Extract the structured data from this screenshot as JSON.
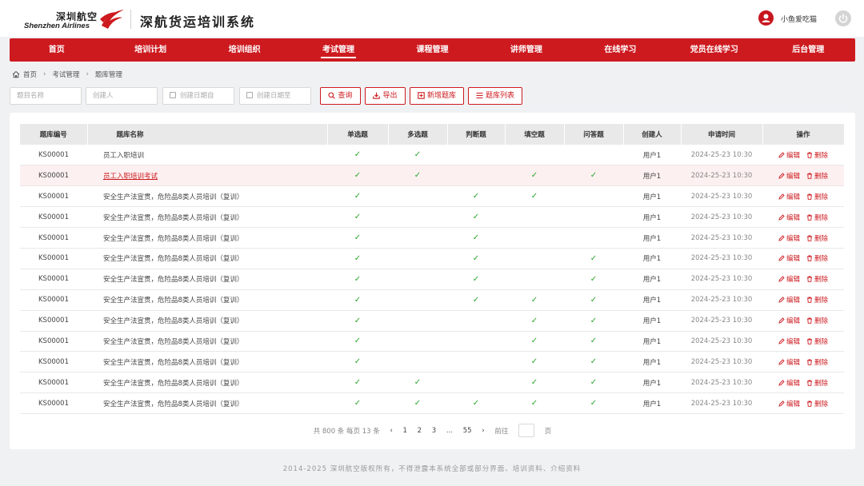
{
  "brand": {
    "logo_cn": "深圳航空",
    "logo_en": "Shenzhen Airlines",
    "system_title": "深航货运培训系统",
    "accent_color": "#cd1a1f"
  },
  "user": {
    "name": "小鱼爱吃猫",
    "avatar_icon": "user-icon",
    "logout_icon": "power-icon"
  },
  "nav": {
    "items": [
      {
        "label": "首页"
      },
      {
        "label": "培训计划"
      },
      {
        "label": "培训组织"
      },
      {
        "label": "考试管理"
      },
      {
        "label": "课程管理"
      },
      {
        "label": "讲师管理"
      },
      {
        "label": "在线学习"
      },
      {
        "label": "党员在线学习"
      },
      {
        "label": "后台管理"
      }
    ],
    "active_index": 3
  },
  "breadcrumb": {
    "home": "首页",
    "level1": "考试管理",
    "level2": "题库管理"
  },
  "filters": {
    "name_placeholder": "题目名称",
    "creator_placeholder": "创建人",
    "date_from_placeholder": "创建日期自",
    "date_to_placeholder": "创建日期至",
    "search_label": "查询",
    "export_label": "导出",
    "add_label": "新增题库",
    "list_label": "题库列表"
  },
  "table": {
    "headers": [
      "题库编号",
      "题库名称",
      "单选题",
      "多选题",
      "判断题",
      "填空题",
      "问答题",
      "创建人",
      "申请时间",
      "操作"
    ],
    "edit_label": "编辑",
    "delete_label": "删除",
    "check_mark": "✓",
    "rows": [
      {
        "id": "KS00001",
        "name": "员工入职培训",
        "single": true,
        "multi": true,
        "judge": false,
        "fill": false,
        "qa": false,
        "creator": "用户1",
        "time": "2024-25-23 10:30",
        "highlight": false
      },
      {
        "id": "KS00001",
        "name": "员工入职培训考试",
        "single": true,
        "multi": true,
        "judge": false,
        "fill": true,
        "qa": true,
        "creator": "用户1",
        "time": "2024-25-23 10:30",
        "highlight": true
      },
      {
        "id": "KS00001",
        "name": "安全生产法宣贯，危险品8类人员培训（复训）",
        "single": true,
        "multi": false,
        "judge": true,
        "fill": true,
        "qa": false,
        "creator": "用户1",
        "time": "2024-25-23 10:30",
        "highlight": false
      },
      {
        "id": "KS00001",
        "name": "安全生产法宣贯，危险品8类人员培训（复训）",
        "single": true,
        "multi": false,
        "judge": true,
        "fill": false,
        "qa": false,
        "creator": "用户1",
        "time": "2024-25-23 10:30",
        "highlight": false
      },
      {
        "id": "KS00001",
        "name": "安全生产法宣贯，危险品8类人员培训（复训）",
        "single": true,
        "multi": false,
        "judge": true,
        "fill": false,
        "qa": false,
        "creator": "用户1",
        "time": "2024-25-23 10:30",
        "highlight": false
      },
      {
        "id": "KS00001",
        "name": "安全生产法宣贯，危险品8类人员培训（复训）",
        "single": true,
        "multi": false,
        "judge": true,
        "fill": false,
        "qa": true,
        "creator": "用户1",
        "time": "2024-25-23 10:30",
        "highlight": false
      },
      {
        "id": "KS00001",
        "name": "安全生产法宣贯，危险品8类人员培训（复训）",
        "single": true,
        "multi": false,
        "judge": true,
        "fill": false,
        "qa": true,
        "creator": "用户1",
        "time": "2024-25-23 10:30",
        "highlight": false
      },
      {
        "id": "KS00001",
        "name": "安全生产法宣贯，危险品8类人员培训（复训）",
        "single": true,
        "multi": false,
        "judge": true,
        "fill": true,
        "qa": true,
        "creator": "用户1",
        "time": "2024-25-23 10:30",
        "highlight": false
      },
      {
        "id": "KS00001",
        "name": "安全生产法宣贯，危险品8类人员培训（复训）",
        "single": true,
        "multi": false,
        "judge": false,
        "fill": true,
        "qa": true,
        "creator": "用户1",
        "time": "2024-25-23 10:30",
        "highlight": false
      },
      {
        "id": "KS00001",
        "name": "安全生产法宣贯，危险品8类人员培训（复训）",
        "single": true,
        "multi": false,
        "judge": false,
        "fill": true,
        "qa": true,
        "creator": "用户1",
        "time": "2024-25-23 10:30",
        "highlight": false
      },
      {
        "id": "KS00001",
        "name": "安全生产法宣贯，危险品8类人员培训（复训）",
        "single": true,
        "multi": false,
        "judge": false,
        "fill": true,
        "qa": true,
        "creator": "用户1",
        "time": "2024-25-23 10:30",
        "highlight": false
      },
      {
        "id": "KS00001",
        "name": "安全生产法宣贯，危险品8类人员培训（复训）",
        "single": true,
        "multi": true,
        "judge": false,
        "fill": true,
        "qa": true,
        "creator": "用户1",
        "time": "2024-25-23 10:30",
        "highlight": false
      },
      {
        "id": "KS00001",
        "name": "安全生产法宣贯，危险品8类人员培训（复训）",
        "single": true,
        "multi": true,
        "judge": true,
        "fill": true,
        "qa": true,
        "creator": "用户1",
        "time": "2024-25-23 10:30",
        "highlight": false
      }
    ]
  },
  "pager": {
    "summary": "共 800 条 每页 13 条",
    "pages": [
      "1",
      "2",
      "3",
      "...",
      "55"
    ],
    "goto_label": "前往",
    "page_unit": "页"
  },
  "footer": {
    "text": "2014-2025 深圳航空版权所有，不得泄露本系统全部或部分界面、培训资料、介绍资料"
  }
}
